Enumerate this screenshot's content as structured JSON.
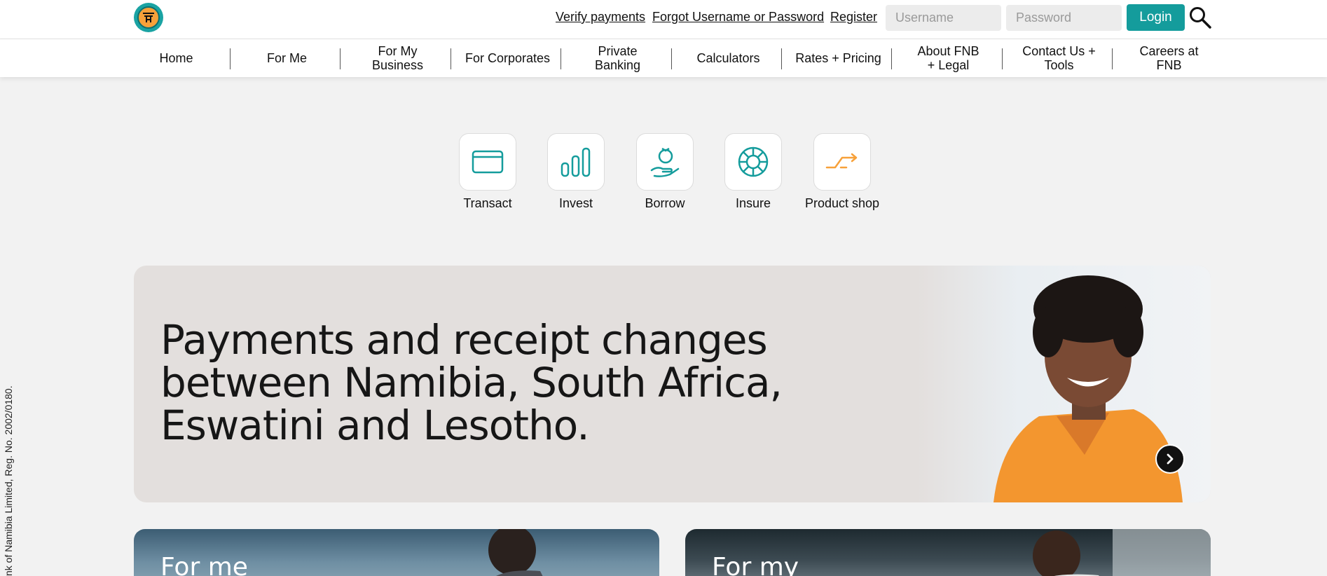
{
  "header": {
    "verify_payments": "Verify payments",
    "forgot": "Forgot Username or Password",
    "register": "Register",
    "username_placeholder": "Username",
    "password_placeholder": "Password",
    "login": "Login"
  },
  "nav": {
    "items": [
      {
        "label": "Home"
      },
      {
        "label": "For Me"
      },
      {
        "label": "For My Business"
      },
      {
        "label": "For Corporates"
      },
      {
        "label": "Private Banking"
      },
      {
        "label": "Calculators"
      },
      {
        "label": "Rates + Pricing"
      },
      {
        "label": "About FNB + Legal"
      },
      {
        "label": "Contact Us + Tools"
      },
      {
        "label": "Careers at FNB"
      }
    ]
  },
  "products": [
    {
      "label": "Transact",
      "icon": "card-icon"
    },
    {
      "label": "Invest",
      "icon": "bar-chart-icon"
    },
    {
      "label": "Borrow",
      "icon": "money-bag-hand-icon"
    },
    {
      "label": "Insure",
      "icon": "lifebuoy-icon"
    },
    {
      "label": "Product shop",
      "icon": "arrows-exchange-icon"
    }
  ],
  "hero": {
    "title": "Payments and receipt changes between Namibia, South Africa, Eswatini and Lesotho."
  },
  "cards": [
    {
      "title": "For me"
    },
    {
      "title": "For my"
    }
  ],
  "legal": {
    "text": "nk of Namibia Limited, Reg. No. 2002/0180."
  },
  "colors": {
    "teal": "#149c9c",
    "orange": "#f7a13a",
    "hero_bg": "#e3dfdd",
    "page_bg": "#f2f2f2"
  }
}
